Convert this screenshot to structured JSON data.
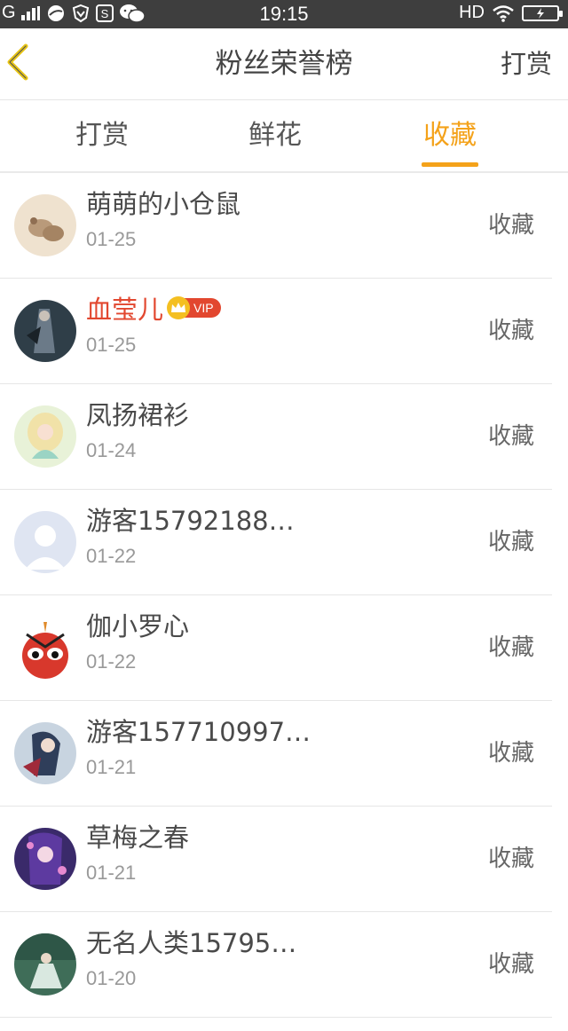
{
  "status_bar": {
    "network": "G",
    "time": "19:15",
    "hd": "HD"
  },
  "nav": {
    "title": "粉丝荣誉榜",
    "action": "打赏"
  },
  "tabs": [
    {
      "label": "打赏",
      "active": false
    },
    {
      "label": "鲜花",
      "active": false
    },
    {
      "label": "收藏",
      "active": true
    }
  ],
  "colors": {
    "accent": "#f4a21a",
    "vip_name": "#e2472f"
  },
  "list": [
    {
      "name": "萌萌的小仓鼠",
      "date": "01-25",
      "action": "收藏",
      "vip": false
    },
    {
      "name": "血莹儿",
      "date": "01-25",
      "action": "收藏",
      "vip": true,
      "vip_label": "VIP"
    },
    {
      "name": "凤扬裙衫",
      "date": "01-24",
      "action": "收藏",
      "vip": false
    },
    {
      "name": "游客15792188…",
      "date": "01-22",
      "action": "收藏",
      "vip": false
    },
    {
      "name": "伽小罗心",
      "date": "01-22",
      "action": "收藏",
      "vip": false
    },
    {
      "name": "游客157710997…",
      "date": "01-21",
      "action": "收藏",
      "vip": false
    },
    {
      "name": "草梅之春",
      "date": "01-21",
      "action": "收藏",
      "vip": false
    },
    {
      "name": "无名人类15795…",
      "date": "01-20",
      "action": "收藏",
      "vip": false
    }
  ]
}
